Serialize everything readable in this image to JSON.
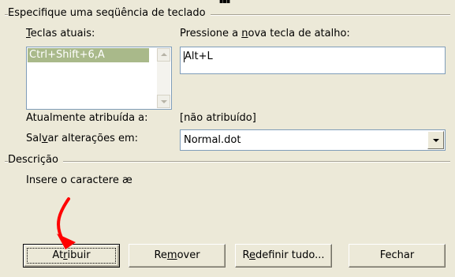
{
  "keyboard_group": {
    "title": "Especifique uma seqüência de teclado",
    "current_keys_label": {
      "before": "",
      "accel": "T",
      "after": "eclas atuais:"
    },
    "current_keys": [
      "Ctrl+Shift+6,A"
    ],
    "new_shortcut_label": {
      "before": "Pressione a ",
      "accel": "n",
      "after": "ova tecla de atalho:"
    },
    "new_shortcut_value": "Alt+L",
    "assigned_label": "Atualmente atribuída a:",
    "assigned_value": "[não atribuído]",
    "save_in_label": {
      "before": "Sal",
      "accel": "v",
      "after": "ar alterações em:"
    },
    "save_in_value": "Normal.dot"
  },
  "description_group": {
    "title": "Descrição",
    "text": "Insere o caractere æ"
  },
  "buttons": {
    "assign": {
      "before": "At",
      "accel": "r",
      "after": "ibuir"
    },
    "remove": {
      "before": "Re",
      "accel": "m",
      "after": "over"
    },
    "reset_all": {
      "before": "R",
      "accel": "e",
      "after": "definir tudo..."
    },
    "close": "Fechar"
  },
  "annotation": {
    "arrow_color": "#ff0000",
    "target": "assign-button"
  },
  "colors": {
    "dialog_bg": "#ece9d8",
    "selection_bg": "#a9b98a",
    "field_border": "#7f9db9"
  }
}
